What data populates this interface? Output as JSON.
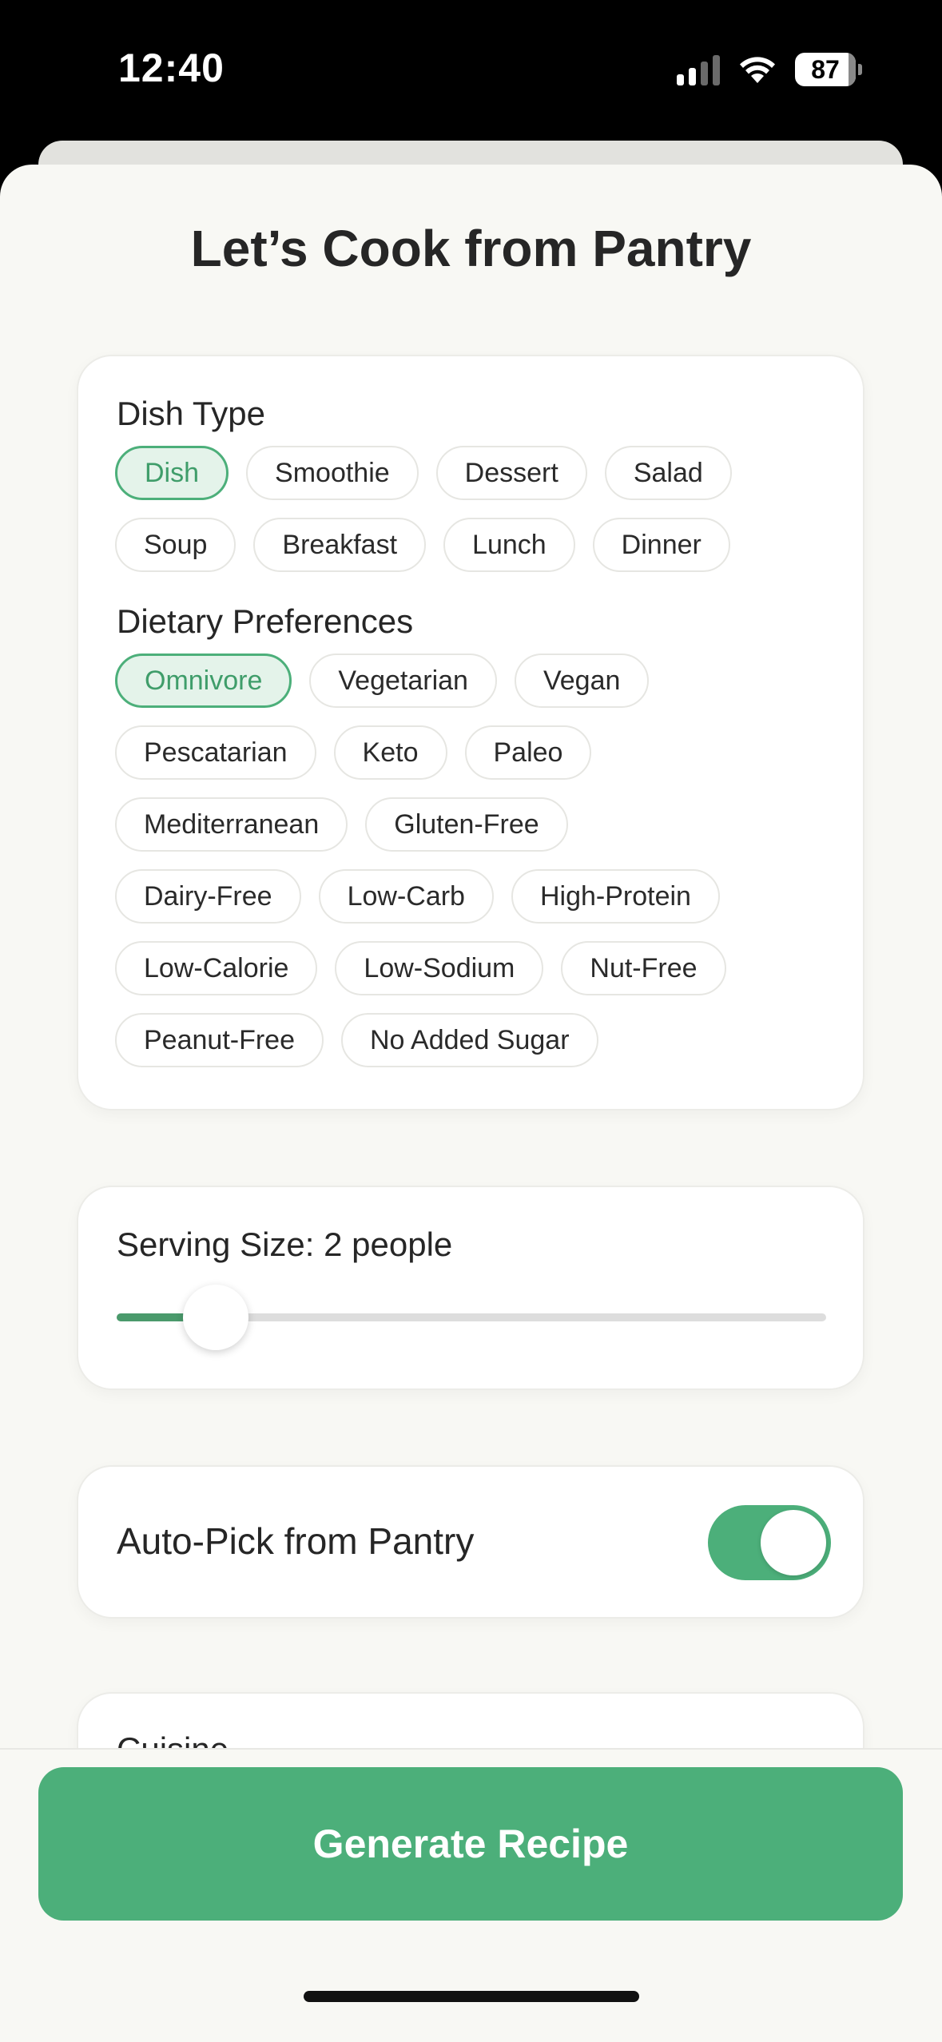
{
  "status_bar": {
    "time": "12:40",
    "battery": "87",
    "icons": [
      "cellular-signal-icon",
      "wifi-icon",
      "battery-icon"
    ]
  },
  "title": "Let’s Cook from Pantry",
  "dish_type": {
    "title": "Dish Type",
    "options": [
      "Dish",
      "Smoothie",
      "Dessert",
      "Salad",
      "Soup",
      "Breakfast",
      "Lunch",
      "Dinner"
    ],
    "selected": "Dish"
  },
  "dietary": {
    "title": "Dietary Preferences",
    "options": [
      "Omnivore",
      "Vegetarian",
      "Vegan",
      "Pescatarian",
      "Keto",
      "Paleo",
      "Mediterranean",
      "Gluten-Free",
      "Dairy-Free",
      "Low-Carb",
      "High-Protein",
      "Low-Calorie",
      "Low-Sodium",
      "Nut-Free",
      "Peanut-Free",
      "No Added Sugar"
    ],
    "selected": "Omnivore"
  },
  "serving": {
    "label": "Serving Size: 2 people",
    "value": 2,
    "fraction": 0.14
  },
  "auto_pick": {
    "label": "Auto-Pick from Pantry",
    "enabled": true
  },
  "cuisine": {
    "title": "Cuisine"
  },
  "generate_label": "Generate Recipe",
  "colors": {
    "accent": "#4caf7a",
    "selected_chip_bg": "#e4f3ea",
    "selected_chip_text": "#3f9d6a",
    "sheet_bg": "#f8f8f4"
  }
}
